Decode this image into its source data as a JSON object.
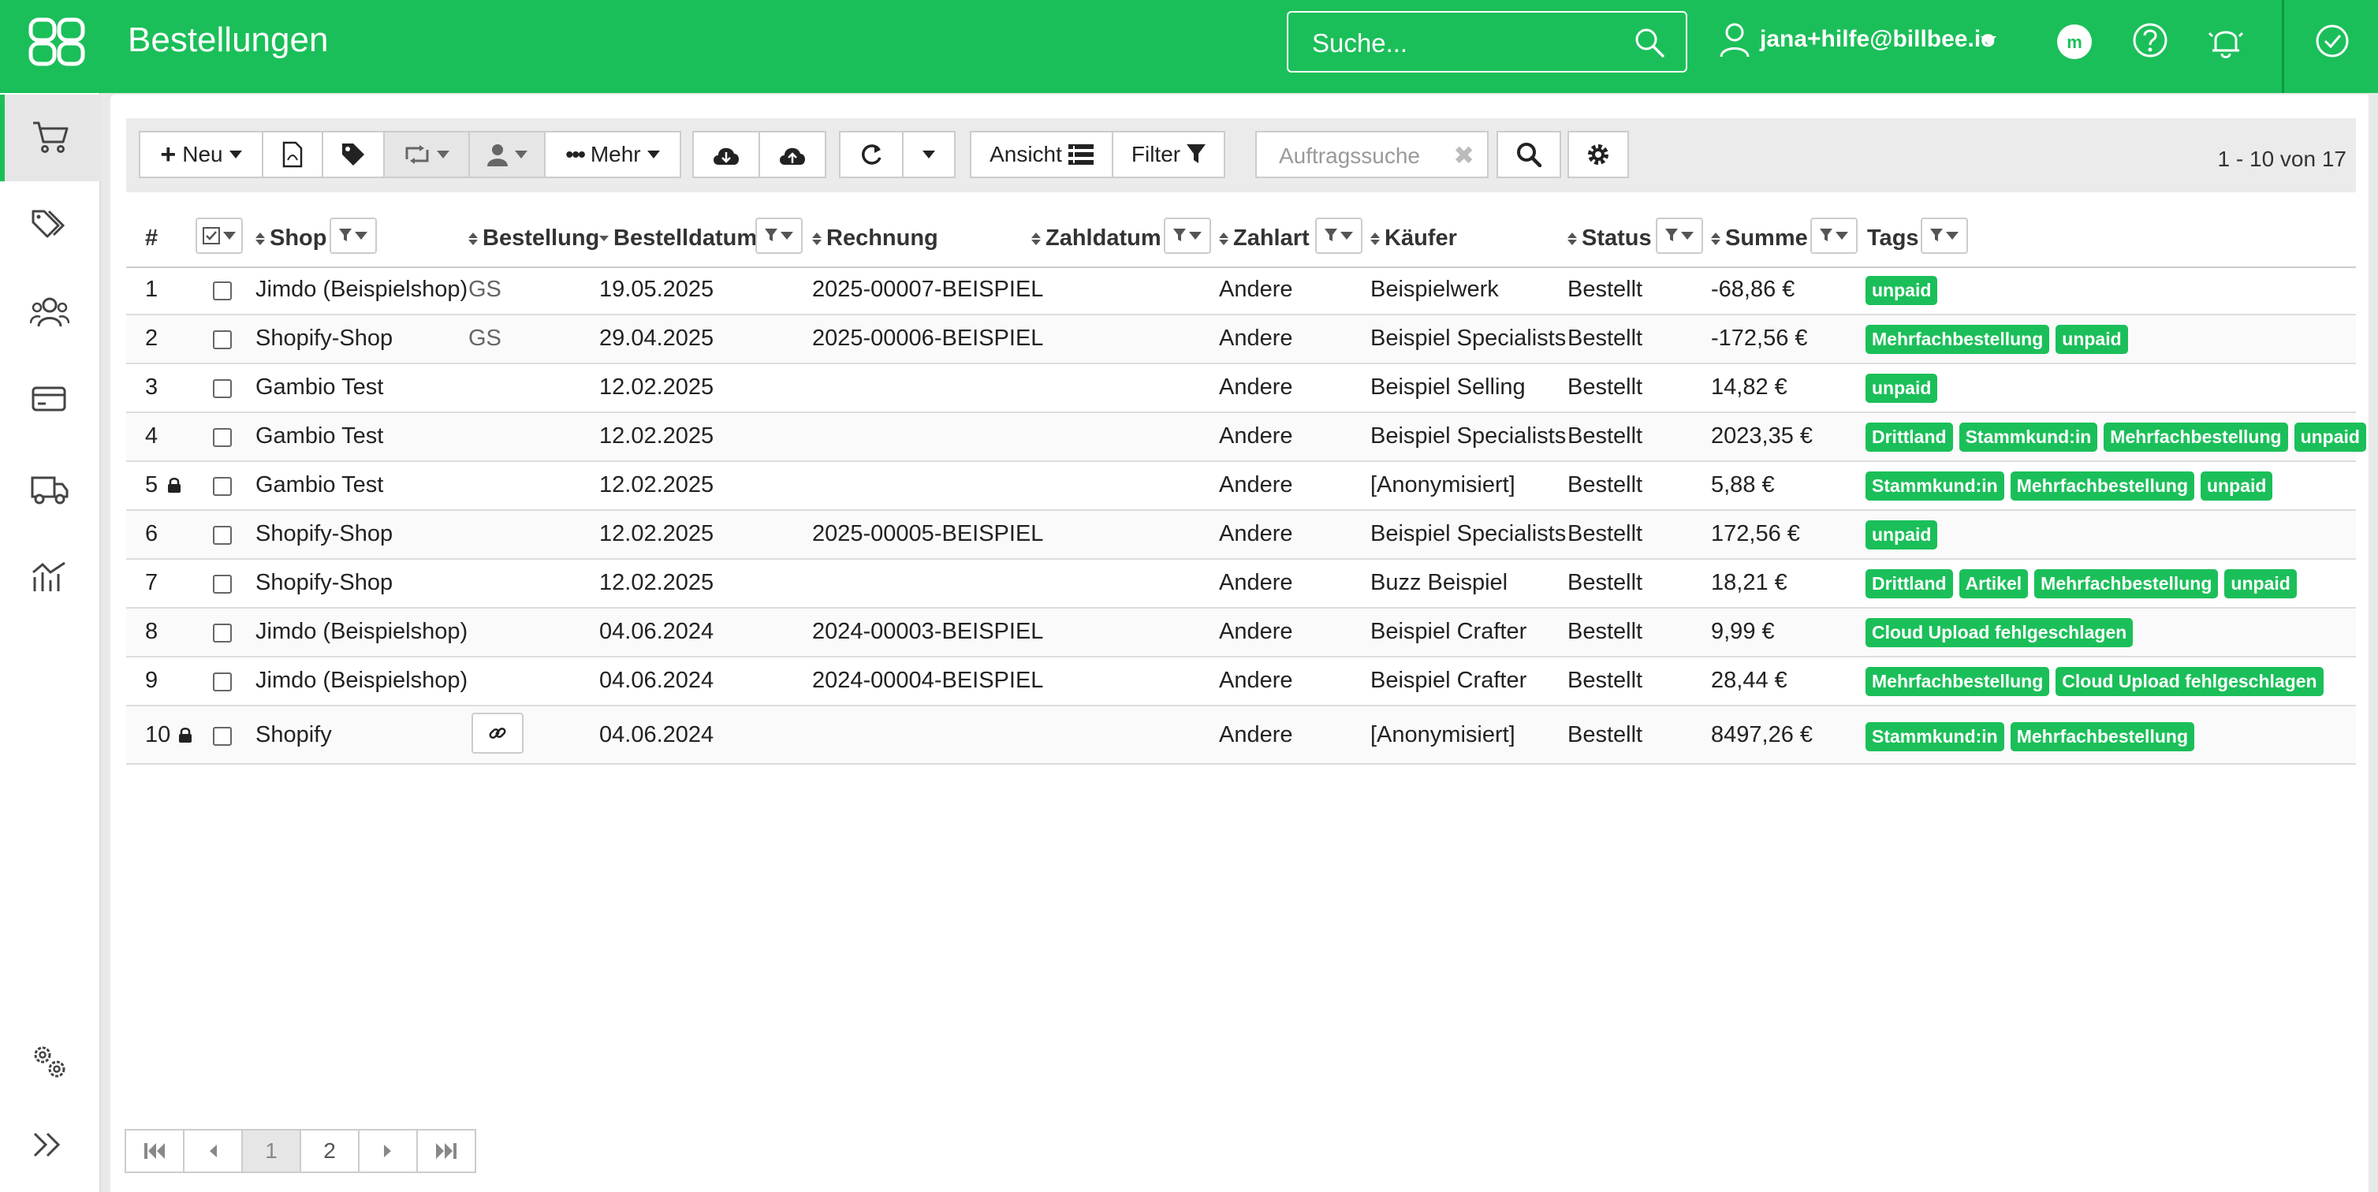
{
  "header": {
    "title": "Bestellungen",
    "search_placeholder": "Suche...",
    "user_email": "jana+hilfe@billbee.io",
    "accent_color": "#1bbf59"
  },
  "sidebar": {
    "items": [
      {
        "icon": "cart-icon",
        "active": true
      },
      {
        "icon": "tags-icon",
        "active": false
      },
      {
        "icon": "users-icon",
        "active": false
      },
      {
        "icon": "credit-card-icon",
        "active": false
      },
      {
        "icon": "truck-icon",
        "active": false
      },
      {
        "icon": "analytics-icon",
        "active": false
      },
      {
        "icon": "settings-gears-icon",
        "active": false
      },
      {
        "icon": "expand-icon",
        "active": false
      }
    ]
  },
  "toolbar": {
    "new_label": "Neu",
    "more_label": "Mehr",
    "view_label": "Ansicht",
    "filter_label": "Filter",
    "order_search_placeholder": "Auftragssuche",
    "count_text": "1 - 10 von 17"
  },
  "table": {
    "columns": [
      "#",
      "Shop",
      "Bestellung",
      "Bestelldatum",
      "Rechnung",
      "Zahldatum",
      "Zahlart",
      "Käufer",
      "Status",
      "Summe",
      "Tags"
    ],
    "rows": [
      {
        "num": "1",
        "locked": false,
        "shop": "Jimdo (Beispielshop)",
        "order": "GS",
        "date": "19.05.2025",
        "invoice": "2025-00007-BEISPIEL",
        "paydate": "",
        "payment": "Andere",
        "buyer": "Beispielwerk",
        "status": "Bestellt",
        "sum": "-68,86 €",
        "tags": [
          "unpaid"
        ]
      },
      {
        "num": "2",
        "locked": false,
        "shop": "Shopify-Shop",
        "order": "GS",
        "date": "29.04.2025",
        "invoice": "2025-00006-BEISPIEL",
        "paydate": "",
        "payment": "Andere",
        "buyer": "Beispiel Specialists",
        "status": "Bestellt",
        "sum": "-172,56 €",
        "tags": [
          "Mehrfachbestellung",
          "unpaid"
        ]
      },
      {
        "num": "3",
        "locked": false,
        "shop": "Gambio Test",
        "order": "",
        "date": "12.02.2025",
        "invoice": "",
        "paydate": "",
        "payment": "Andere",
        "buyer": "Beispiel Selling",
        "status": "Bestellt",
        "sum": "14,82 €",
        "tags": [
          "unpaid"
        ]
      },
      {
        "num": "4",
        "locked": false,
        "shop": "Gambio Test",
        "order": "",
        "date": "12.02.2025",
        "invoice": "",
        "paydate": "",
        "payment": "Andere",
        "buyer": "Beispiel Specialists",
        "status": "Bestellt",
        "sum": "2023,35 €",
        "tags": [
          "Drittland",
          "Stammkund:in",
          "Mehrfachbestellung",
          "unpaid"
        ]
      },
      {
        "num": "5",
        "locked": true,
        "shop": "Gambio Test",
        "order": "",
        "date": "12.02.2025",
        "invoice": "",
        "paydate": "",
        "payment": "Andere",
        "buyer": "[Anonymisiert]",
        "status": "Bestellt",
        "sum": "5,88 €",
        "tags": [
          "Stammkund:in",
          "Mehrfachbestellung",
          "unpaid"
        ]
      },
      {
        "num": "6",
        "locked": false,
        "shop": "Shopify-Shop",
        "order": "",
        "date": "12.02.2025",
        "invoice": "2025-00005-BEISPIEL",
        "paydate": "",
        "payment": "Andere",
        "buyer": "Beispiel Specialists",
        "status": "Bestellt",
        "sum": "172,56 €",
        "tags": [
          "unpaid"
        ]
      },
      {
        "num": "7",
        "locked": false,
        "shop": "Shopify-Shop",
        "order": "",
        "date": "12.02.2025",
        "invoice": "",
        "paydate": "",
        "payment": "Andere",
        "buyer": "Buzz Beispiel",
        "status": "Bestellt",
        "sum": "18,21 €",
        "tags": [
          "Drittland",
          "Artikel",
          "Mehrfachbestellung",
          "unpaid"
        ]
      },
      {
        "num": "8",
        "locked": false,
        "shop": "Jimdo (Beispielshop)",
        "order": "",
        "date": "04.06.2024",
        "invoice": "2024-00003-BEISPIEL",
        "paydate": "",
        "payment": "Andere",
        "buyer": "Beispiel Crafter",
        "status": "Bestellt",
        "sum": "9,99 €",
        "tags": [
          "Cloud Upload fehlgeschlagen"
        ]
      },
      {
        "num": "9",
        "locked": false,
        "shop": "Jimdo (Beispielshop)",
        "order": "",
        "date": "04.06.2024",
        "invoice": "2024-00004-BEISPIEL",
        "paydate": "",
        "payment": "Andere",
        "buyer": "Beispiel Crafter",
        "status": "Bestellt",
        "sum": "28,44 €",
        "tags": [
          "Mehrfachbestellung",
          "Cloud Upload fehlgeschlagen"
        ]
      },
      {
        "num": "10",
        "locked": true,
        "shop": "Shopify",
        "order": "",
        "date": "04.06.2024",
        "invoice": "",
        "paydate": "",
        "payment": "Andere",
        "buyer": "[Anonymisiert]",
        "status": "Bestellt",
        "sum": "8497,26 €",
        "tags": [
          "Stammkund:in",
          "Mehrfachbestellung"
        ],
        "order_link": true
      }
    ]
  },
  "pagination": {
    "pages": [
      "1",
      "2"
    ],
    "current": "1"
  }
}
